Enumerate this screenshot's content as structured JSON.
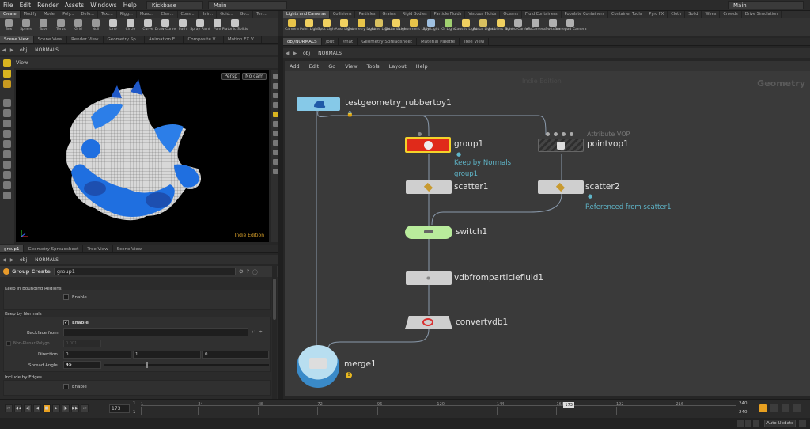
{
  "menubar": {
    "items": [
      "File",
      "Edit",
      "Render",
      "Assets",
      "Windows",
      "Help"
    ],
    "desktop_left": "Kickbase",
    "desktop_mid": "Main",
    "desktop_right": "Main"
  },
  "shelf_left": {
    "tabs": [
      "Create",
      "Modify",
      "Model",
      "Poly...",
      "Defo...",
      "Text...",
      "Rigg...",
      "Musc...",
      "Char...",
      "Cons...",
      "Hair...",
      "Guid...",
      "Go...",
      "Terr..."
    ],
    "tools": [
      "Box",
      "Sphere",
      "Tube",
      "Torus",
      "Grid",
      "Null",
      "Line",
      "Circle",
      "Curve",
      "Draw Curve",
      "Path",
      "Spray Paint",
      "Font",
      "Platonic Solids"
    ]
  },
  "shelf_right": {
    "tabs": [
      "Lights and Cameras",
      "Collisions",
      "Particles",
      "Grains",
      "Rigid Bodies",
      "Particle Fluids",
      "Viscous Fluids",
      "Oceans",
      "Fluid Containers",
      "Populate Containers",
      "Container Tools",
      "Pyro FX",
      "Cloth",
      "Solid",
      "Wires",
      "Crowds",
      "Drive Simulation"
    ],
    "tools": [
      "Camera",
      "Point Light",
      "Spot Light",
      "Area Light",
      "Geometry Light",
      "Volume Light",
      "Distant Light",
      "Environment Light",
      "Sky Light",
      "GI Light",
      "Caustic Light",
      "Portal Light",
      "Ambient Light",
      "Stereo Camera",
      "VR Camera",
      "Switcher",
      "Gamepad Camera"
    ]
  },
  "left_pane": {
    "tabs": [
      "Scene View",
      "Scene View",
      "Render View",
      "Geometry Sp...",
      "Animation E...",
      "Composite V...",
      "Motion FX V..."
    ],
    "path_root": "obj",
    "path_node": "NORMALS",
    "view_label": "View",
    "persp": "Persp",
    "cam": "No cam",
    "watermark": "Indie Edition"
  },
  "params_pane": {
    "tabs": [
      "group1",
      "Geometry Spreadsheet",
      "Tree View",
      "Scene View"
    ],
    "path_root": "obj",
    "path_node": "NORMALS",
    "node_type": "Group Create",
    "node_name": "group1",
    "sections": {
      "bounding": "Keep in Bounding Regions",
      "normals": "Keep by Normals",
      "edges": "Include by Edges"
    },
    "enable": "Enable",
    "backface_label": "Backface from",
    "nonplanar_label": "Non-Planar Polygo...",
    "nonplanar_value": "0.001",
    "direction_label": "Direction",
    "direction_values": [
      "0",
      "1",
      "0"
    ],
    "spread_label": "Spread Angle",
    "spread_value": "45",
    "spread_fraction": 0.25
  },
  "right_pane": {
    "tabs": [
      "obj/NORMALS",
      "/out",
      "/mat",
      "Geometry Spreadsheet",
      "Material Palette",
      "Tree View"
    ],
    "path_root": "obj",
    "path_node": "NORMALS",
    "menu": [
      "Add",
      "Edit",
      "Go",
      "View",
      "Tools",
      "Layout",
      "Help"
    ],
    "watermark": "Indie Edition",
    "context": "Geometry"
  },
  "nodes": {
    "rubbertoy": "testgeometry_rubbertoy1",
    "group1": "group1",
    "group1_note1": "Keep by Normals",
    "group1_note2": "group1",
    "pointvop_type": "Attribute VOP",
    "pointvop": "pointvop1",
    "scatter1": "scatter1",
    "scatter2": "scatter2",
    "scatter2_note": "Referenced from scatter1",
    "switch1": "switch1",
    "vdb": "vdbfromparticlefluid1",
    "convert": "convertvdb1",
    "merge": "merge1"
  },
  "timeline": {
    "current_frame": "173",
    "start": "1",
    "start2": "1",
    "end": "240",
    "end2": "240",
    "ticks": [
      "1",
      "24",
      "48",
      "72",
      "96",
      "120",
      "144",
      "168",
      "192",
      "216"
    ],
    "marker": "173",
    "auto_update": "Auto Update"
  },
  "colors": {
    "group_red": "#e02a1a",
    "switch_green": "#b9ec9c",
    "node_blue": "#86c9e8",
    "note_cyan": "#5fb5c8"
  }
}
